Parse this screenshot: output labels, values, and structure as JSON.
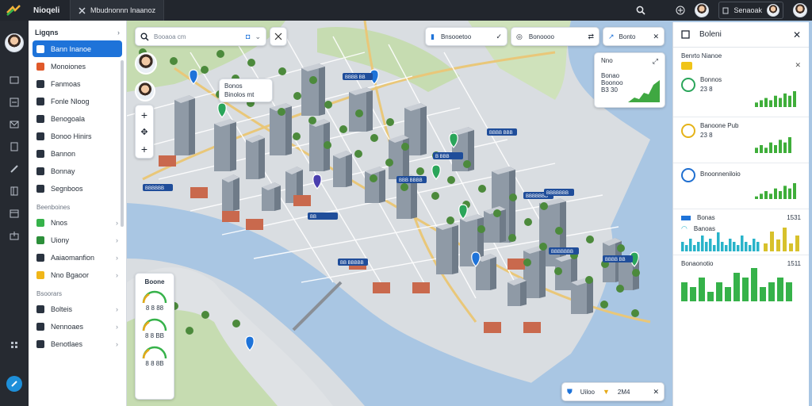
{
  "topbar": {
    "app_name": "Nioqeli",
    "tab_label": "Mbudnonnn Inaanoz",
    "user_label": "Senaoak"
  },
  "sidebar": {
    "header": "Ligqns",
    "items": [
      {
        "label": "Bann Inanoe",
        "color": "#ffffff",
        "icon": "map-icon"
      },
      {
        "label": "Monoiones",
        "color": "#e0592a",
        "icon": "layers-icon"
      },
      {
        "label": "Fanmoas",
        "color": "#2a3340",
        "icon": "folder-icon"
      },
      {
        "label": "Fonle Nloog",
        "color": "#2a3340",
        "icon": "grid-icon"
      },
      {
        "label": "Benogoala",
        "color": "#2a3340",
        "icon": "pin-icon"
      },
      {
        "label": "Bonoo Hinirs",
        "color": "#2a3340",
        "icon": "building-icon"
      },
      {
        "label": "Bannon",
        "color": "#2a3340",
        "icon": "truck-icon"
      },
      {
        "label": "Bonnay",
        "color": "#2a3340",
        "icon": "chart-icon"
      },
      {
        "label": "Segnboos",
        "color": "#2a3340",
        "icon": "settings-icon"
      }
    ],
    "section1": "Beenboines",
    "items2": [
      {
        "label": "Nnos",
        "color": "#36b24a",
        "icon": "globe-icon"
      },
      {
        "label": "Uiony",
        "color": "#2c8f3a",
        "icon": "shield-icon"
      },
      {
        "label": "Aaiaomanfion",
        "color": "#2a3340",
        "icon": "route-icon"
      },
      {
        "label": "Nno Bgaoor",
        "color": "#f0b619",
        "icon": "star-icon"
      }
    ],
    "section2": "Bsoorars",
    "items3": [
      {
        "label": "Bolteis",
        "color": "#2a3340",
        "icon": "table-icon"
      },
      {
        "label": "Nennoaes",
        "color": "#2a3340",
        "icon": "image-icon"
      },
      {
        "label": "Benotlaes",
        "color": "#2a3340",
        "icon": "car-icon"
      }
    ]
  },
  "map": {
    "search_placeholder": "Booaoa cm",
    "filter1": "Bnsooetoo",
    "filter2": "Bonoooo",
    "filter3": "Bonto",
    "popup": {
      "line1": "Bonos",
      "line2": "Binolos mt"
    },
    "mini_chart": {
      "title": "Nno",
      "line1": "Bonao",
      "line2": "Boonoo",
      "line3": "B3 30"
    },
    "bottom_bar": {
      "label": "Uiloo",
      "value": "2M4"
    },
    "legend_title": "Boone",
    "legend_items": [
      "8 8 88",
      "8 8 BB",
      "8 8 8B"
    ],
    "tags": [
      "BBBB BB",
      "BBBBBB",
      "BBB BBBB",
      "BBBB BBB",
      "BBBBBBB",
      "BB",
      "BB BBBBB",
      "BBBBBBB",
      "BBBB BB",
      "BBBBBBB",
      "B BBB"
    ]
  },
  "right_panel": {
    "title": "Boleni",
    "subtitle": "Benrto Nianoe",
    "rows": [
      {
        "title": "Bonnos",
        "value": "23 8",
        "icon": "#2aa55a",
        "bars": [
          2,
          3,
          4,
          3,
          5,
          4,
          6,
          5,
          7
        ]
      },
      {
        "title": "Banoone Pub",
        "value": "23 8",
        "icon": "#e5b319",
        "bars": [
          2,
          3,
          2,
          4,
          3,
          5,
          4,
          6
        ]
      },
      {
        "title": "Bnoonneniloio",
        "value": "",
        "icon": "#1f6fd0",
        "bars": [
          1,
          2,
          3,
          2,
          4,
          3,
          5,
          4,
          6
        ]
      }
    ],
    "row_bonas": {
      "title": "Bonas",
      "value": "1531"
    },
    "row_banos": {
      "title": "Banoas"
    },
    "row_boon": {
      "title": "Bonaonotio",
      "value": "1511"
    },
    "row_small": {
      "title": "Bonono",
      "value": "1511"
    },
    "colors": {
      "accent": "#1e73d9",
      "green": "#36b24a",
      "teal": "#28b3c9",
      "yellow": "#d7c12c"
    },
    "teal_bars": [
      3,
      2,
      4,
      2,
      3,
      5,
      3,
      4,
      2,
      6,
      3,
      2,
      4,
      3,
      2,
      5,
      3,
      2,
      4,
      3
    ],
    "yellow_bars": [
      2,
      5,
      3,
      6,
      2,
      4
    ],
    "green_bars": [
      4,
      3,
      5,
      2,
      4,
      3,
      6,
      5,
      7,
      3,
      4,
      5,
      4
    ]
  }
}
